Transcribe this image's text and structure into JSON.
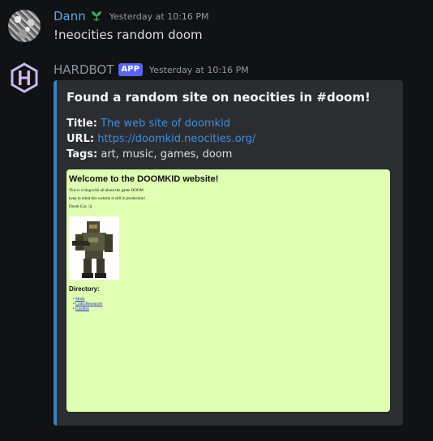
{
  "messages": [
    {
      "username": "Dann",
      "timestamp": "Yesterday at 10:16 PM",
      "text": "!neocities random doom",
      "badge_icon": "leaf-badge-icon"
    },
    {
      "username": "HARDBOT",
      "app_tag": "APP",
      "timestamp": "Yesterday at 10:16 PM",
      "embed": {
        "title": "Found a random site on neocities in #doom!",
        "title_label": "Title:",
        "title_value": "The web site of doomkid",
        "url_label": "URL:",
        "url_value": "https://doomkid.neocities.org/",
        "tags_label": "Tags:",
        "tags_value": "art, music, games, doom",
        "preview": {
          "heading": "Welcome to the DOOMKID website!",
          "line1": "This is a blog/wiki all about the game DOOM",
          "line2": "keep in mind this website is still in production!",
          "line3": "Doom Guy ;))",
          "directory_label": "Directory:",
          "links": [
            "Mods",
            "Links/Resources",
            "Goodies"
          ]
        }
      }
    }
  ],
  "colors": {
    "background": "#111214",
    "dann_name": "#5ea8e8",
    "bot_name": "#8d93a0",
    "app_tag": "#5865f2",
    "embed_bar": "#3b82c4",
    "link": "#3c8fe0",
    "preview_bg": "#dffeb2"
  }
}
